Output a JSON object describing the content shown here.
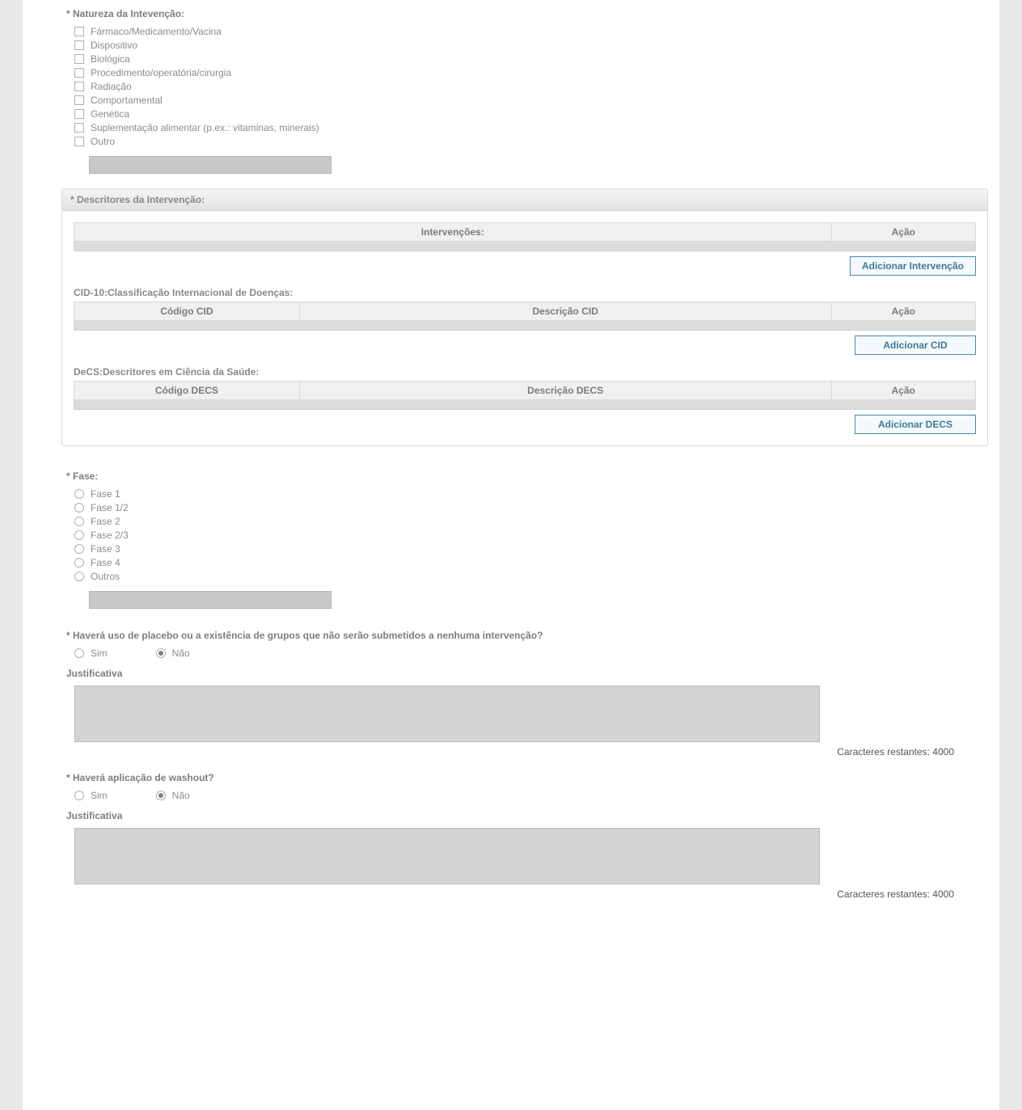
{
  "nature": {
    "label": "* Natureza da Intevenção:",
    "options": [
      "Fármaco/Medicamento/Vacina",
      "Dispositivo",
      "Biológica",
      "Procedimento/operatória/cirurgia",
      "Radiação",
      "Comportamental",
      "Genética",
      "Suplementação alimentar (p.ex.: vitaminas, minerais)",
      "Outro"
    ]
  },
  "descritores": {
    "header": "* Descritores da Intervenção:",
    "intervencoes_th1": "Intervenções:",
    "acao": "Ação",
    "btn_add_interv": "Adicionar Intervenção",
    "cid_title": "CID-10:Classificação Internacional de Doenças:",
    "cid_th1": "Código CID",
    "cid_th2": "Descrição CID",
    "btn_add_cid": "Adicionar CID",
    "decs_title": "DeCS:Descritores em Ciência da Saúde:",
    "decs_th1": "Código DECS",
    "decs_th2": "Descrição DECS",
    "btn_add_decs": "Adicionar DECS"
  },
  "fase": {
    "label": "* Fase:",
    "options": [
      "Fase 1",
      "Fase 1/2",
      "Fase 2",
      "Fase 2/3",
      "Fase 3",
      "Fase 4",
      "Outros"
    ]
  },
  "placebo": {
    "label": "* Haverá uso de placebo ou a existência de grupos que não serão submetidos a nenhuma intervenção?",
    "yes": "Sim",
    "no": "Não",
    "just": "Justificativa",
    "chars": "Caracteres restantes: 4000"
  },
  "washout": {
    "label": "* Haverá aplicação de washout?",
    "yes": "Sim",
    "no": "Não",
    "just": "Justificativa",
    "chars": "Caracteres restantes: 4000"
  }
}
